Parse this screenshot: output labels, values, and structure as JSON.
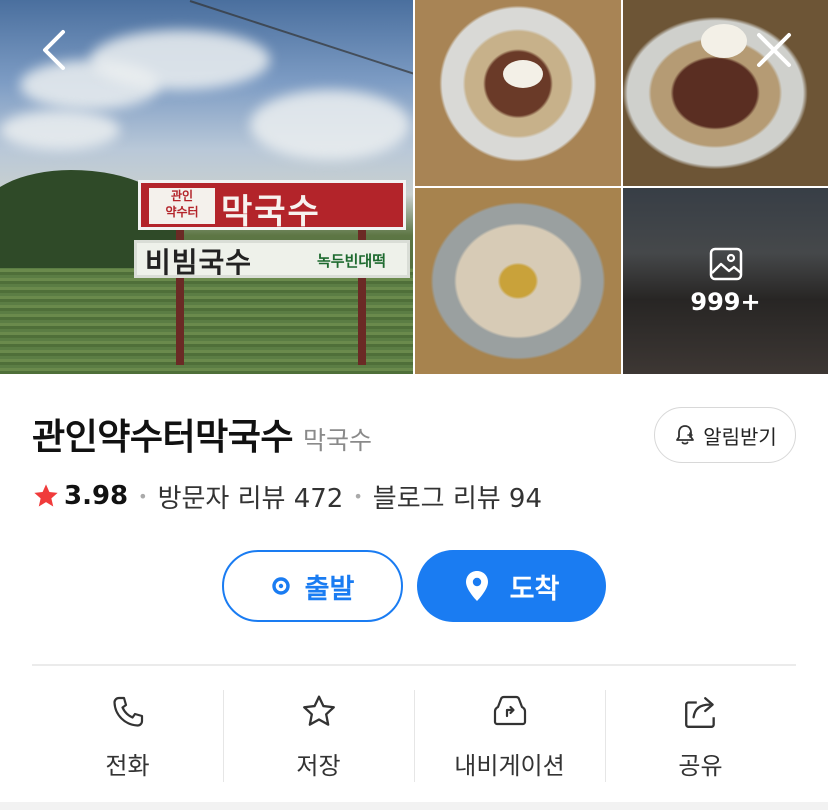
{
  "place": {
    "name": "관인약수터막국수",
    "category": "막국수",
    "rating": "3.98",
    "visitor_reviews": "방문자 리뷰 472",
    "blog_reviews": "블로그 리뷰 94"
  },
  "photos": {
    "more_count": "999+",
    "sign_small_line1": "관인",
    "sign_small_line2": "약수터",
    "sign_big": "막국수",
    "sign_white_big": "비빔국수",
    "sign_white_small": "녹두빈대떡"
  },
  "buttons": {
    "notify": "알림받기",
    "depart": "출발",
    "arrive": "도착"
  },
  "actions": [
    {
      "label": "전화",
      "icon": "phone-icon"
    },
    {
      "label": "저장",
      "icon": "star-icon"
    },
    {
      "label": "내비게이션",
      "icon": "navigation-icon"
    },
    {
      "label": "공유",
      "icon": "share-icon"
    }
  ],
  "colors": {
    "accent": "#1a7cf2",
    "rating_star": "#f03b3b"
  }
}
